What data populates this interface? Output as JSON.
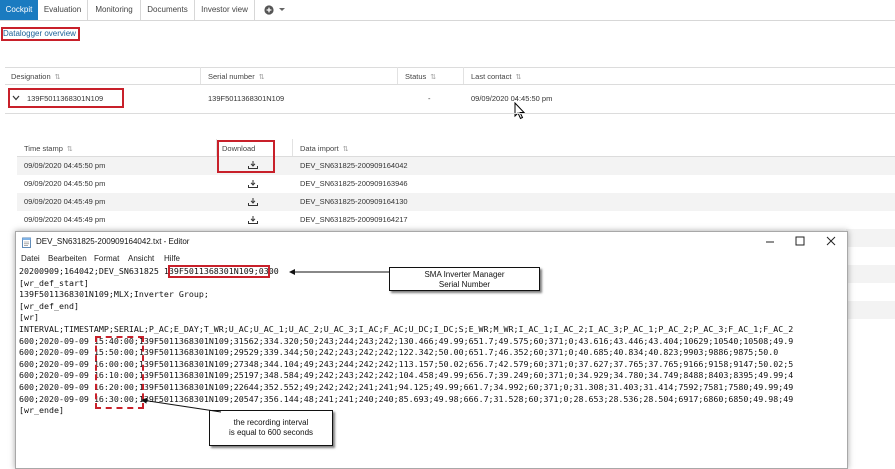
{
  "tabs": [
    {
      "label": "Cockpit",
      "active": true
    },
    {
      "label": "Evaluation",
      "active": false
    },
    {
      "label": "Monitoring",
      "active": false
    },
    {
      "label": "Documents",
      "active": false
    },
    {
      "label": "Investor view",
      "active": false
    }
  ],
  "tab_add_icon": "plus-circle-icon",
  "section_title": "Datalogger overview",
  "devices_table": {
    "columns": [
      "Designation",
      "Serial number",
      "Status",
      "Last contact"
    ],
    "row": {
      "designation": "139F5011368301N109",
      "serial": "139F5011368301N109",
      "status": "-",
      "last_contact": "09/09/2020 04:45:50 pm"
    }
  },
  "files_table": {
    "columns": [
      "Time stamp",
      "Download",
      "Data import"
    ],
    "rows": [
      {
        "time": "09/09/2020 04:45:50 pm",
        "file": "DEV_SN631825-200909164042"
      },
      {
        "time": "09/09/2020 04:45:50 pm",
        "file": "DEV_SN631825-200909163946"
      },
      {
        "time": "09/09/2020 04:45:49 pm",
        "file": "DEV_SN631825-200909164130"
      },
      {
        "time": "09/09/2020 04:45:49 pm",
        "file": "DEV_SN631825-200909164217"
      }
    ]
  },
  "editor": {
    "title": "DEV_SN631825-200909164042.txt - Editor",
    "menu": [
      "Datei",
      "Bearbeiten",
      "Format",
      "Ansicht",
      "Hilfe"
    ],
    "header_line": {
      "prefix": "20200909;164042;DEV_SN631825 ",
      "serial": "139F5011368301N109",
      "suffix": ";0300"
    },
    "lines": [
      "[wr_def_start]",
      "139F5011368301N109;MLX;Inverter Group;",
      "[wr_def_end]",
      "[wr]",
      "INTERVAL;TIMESTAMP;SERIAL;P_AC;E_DAY;T_WR;U_AC;U_AC_1;U_AC_2;U_AC_3;I_AC;F_AC;U_DC;I_DC;S;E_WR;M_WR;I_AC_1;I_AC_2;I_AC_3;P_AC_1;P_AC_2;P_AC_3;F_AC_1;F_AC_2"
    ],
    "data_rows": [
      {
        "prefix": "600;2020-09-09 ",
        "time": "15:40:00",
        "rest": ";139F5011368301N109;31562;334.320;50;243;244;243;242;130.466;49.99;651.7;49.575;60;371;0;43.616;43.446;43.404;10629;10540;10508;49.9"
      },
      {
        "prefix": "600;2020-09-09 ",
        "time": "15:50:00",
        "rest": ";139F5011368301N109;29529;339.344;50;242;243;242;242;122.342;50.00;651.7;46.352;60;371;0;40.685;40.834;40.823;9903;9886;9875;50.0"
      },
      {
        "prefix": "600;2020-09-09 ",
        "time": "16:00:00",
        "rest": ";139F5011368301N109;27348;344.104;49;243;244;242;242;113.157;50.02;656.7;42.579;60;371;0;37.627;37.765;37.765;9166;9158;9147;50.02;5"
      },
      {
        "prefix": "600;2020-09-09 ",
        "time": "16:10:00",
        "rest": ";139F5011368301N109;25197;348.584;49;242;243;242;242;104.458;49.99;656.7;39.249;60;371;0;34.929;34.780;34.749;8488;8403;8395;49.99;4"
      },
      {
        "prefix": "600;2020-09-09 ",
        "time": "16:20:00",
        "rest": ";139F5011368301N109;22644;352.552;49;242;242;241;241;94.125;49.99;661.7;34.992;60;371;0;31.308;31.403;31.414;7592;7581;7580;49.99;49"
      },
      {
        "prefix": "600;2020-09-09 ",
        "time": "16:30:00",
        "rest": ";139F5011368301N109;20547;356.144;48;241;241;240;240;85.693;49.98;666.7;31.528;60;371;0;28.653;28.536;28.504;6917;6860;6850;49.98;49"
      }
    ],
    "end_line": "[wr_ende]"
  },
  "callouts": {
    "serial": [
      "SMA Inverter Manager",
      "Serial Number"
    ],
    "interval": [
      "the recording interval",
      "is equal to 600 seconds"
    ]
  },
  "colors": {
    "accent": "#1a7bc0",
    "highlight": "#c8202a"
  }
}
